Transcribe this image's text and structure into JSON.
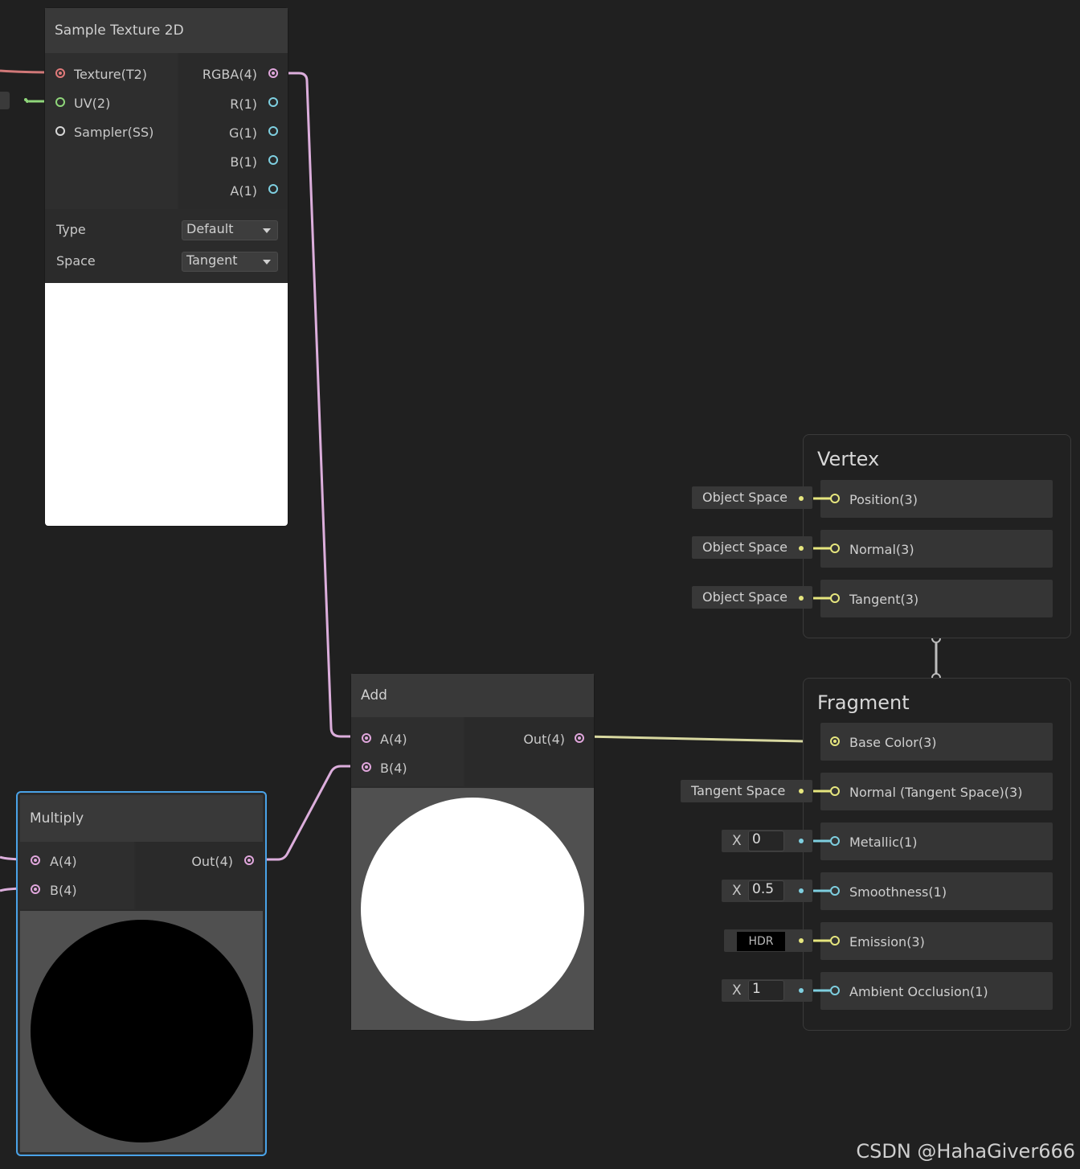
{
  "colors": {
    "background": "#202020",
    "texture_port": "#e07a7a",
    "uv_port": "#8fd67a",
    "vector4_port": "#e0a6dc",
    "vector1_port": "#7ecfe0",
    "vector3_port": "#e6e67e",
    "selection": "#4aa3e8"
  },
  "sample_texture_node": {
    "title": "Sample Texture 2D",
    "inputs": [
      {
        "label": "Texture(T2)",
        "icon": "texture-port-icon"
      },
      {
        "label": "UV(2)",
        "icon": "uv-port-icon"
      },
      {
        "label": "Sampler(SS)",
        "icon": "sampler-port-icon"
      }
    ],
    "outputs": [
      {
        "label": "RGBA(4)"
      },
      {
        "label": "R(1)"
      },
      {
        "label": "G(1)"
      },
      {
        "label": "B(1)"
      },
      {
        "label": "A(1)"
      }
    ],
    "type_label": "Type",
    "type_value": "Default",
    "space_label": "Space",
    "space_value": "Tangent",
    "preview": "white"
  },
  "add_node": {
    "title": "Add",
    "inputs": [
      {
        "label": "A(4)"
      },
      {
        "label": "B(4)"
      }
    ],
    "output": "Out(4)",
    "preview": "white sphere"
  },
  "multiply_node": {
    "title": "Multiply",
    "inputs": [
      {
        "label": "A(4)"
      },
      {
        "label": "B(4)"
      }
    ],
    "output": "Out(4)",
    "preview": "black sphere",
    "selected": true
  },
  "vertex": {
    "title": "Vertex",
    "slots": [
      {
        "label": "Position(3)",
        "chip": "Object Space"
      },
      {
        "label": "Normal(3)",
        "chip": "Object Space"
      },
      {
        "label": "Tangent(3)",
        "chip": "Object Space"
      }
    ]
  },
  "fragment": {
    "title": "Fragment",
    "slots": [
      {
        "label": "Base Color(3)"
      },
      {
        "label": "Normal (Tangent Space)(3)",
        "chip": "Tangent Space"
      },
      {
        "label": "Metallic(1)",
        "axis": "X",
        "value": "0"
      },
      {
        "label": "Smoothness(1)",
        "axis": "X",
        "value": "0.5"
      },
      {
        "label": "Emission(3)",
        "hdr": "HDR"
      },
      {
        "label": "Ambient Occlusion(1)",
        "axis": "X",
        "value": "1"
      }
    ]
  },
  "watermark": "CSDN @HahaGiver666"
}
